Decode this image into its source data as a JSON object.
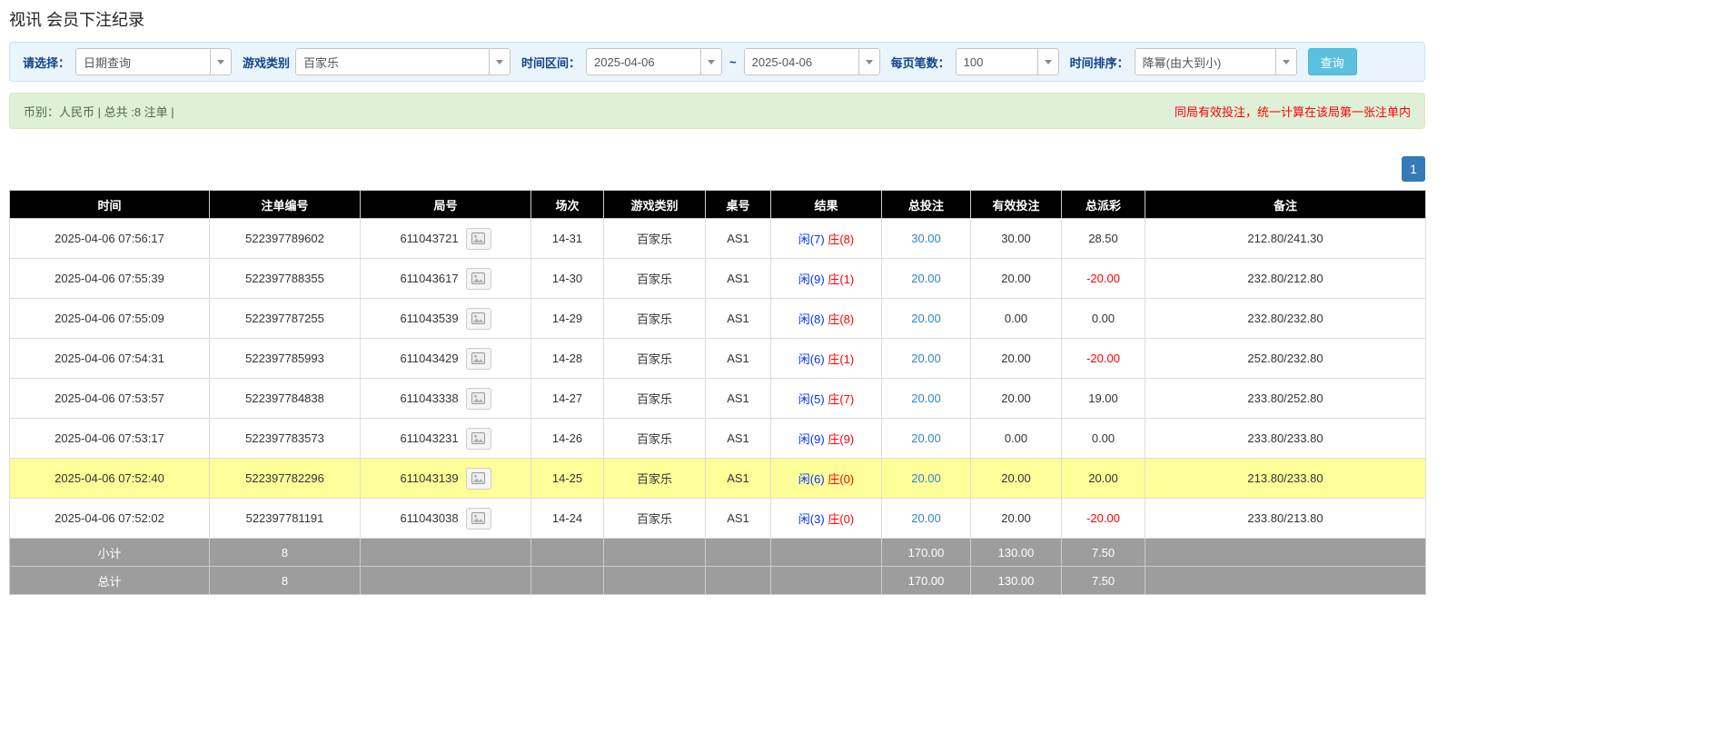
{
  "page": {
    "title": "视讯 会员下注纪录"
  },
  "filters": {
    "select_label": "请选择：",
    "select_value": "日期查询",
    "game_type_label": "游戏类别",
    "game_type_value": "百家乐",
    "time_range_label": "时间区间：",
    "date_from": "2025-04-06",
    "tilde": "~",
    "date_to": "2025-04-06",
    "page_size_label": "每页笔数：",
    "page_size_value": "100",
    "sort_label": "时间排序：",
    "sort_value": "降幂(由大到小)",
    "search_button": "查询"
  },
  "summary": {
    "left": "币别：人民币 | 总共 :8 注单 |",
    "right": "同局有效投注，统一计算在该局第一张注单内"
  },
  "pagination": {
    "current": "1"
  },
  "table": {
    "headers": [
      "时间",
      "注单编号",
      "局号",
      "场次",
      "游戏类别",
      "桌号",
      "结果",
      "总投注",
      "有效投注",
      "总派彩",
      "备注"
    ],
    "rows": [
      {
        "time": "2025-04-06 07:56:17",
        "bet_id": "522397789602",
        "round_id": "611043721",
        "session": "14-31",
        "game": "百家乐",
        "table_no": "AS1",
        "player": "闲(7)",
        "banker": "庄(8)",
        "total_bet": "30.00",
        "valid_bet": "30.00",
        "payout": "28.50",
        "note": "212.80/241.30",
        "highlight": false
      },
      {
        "time": "2025-04-06 07:55:39",
        "bet_id": "522397788355",
        "round_id": "611043617",
        "session": "14-30",
        "game": "百家乐",
        "table_no": "AS1",
        "player": "闲(9)",
        "banker": "庄(1)",
        "total_bet": "20.00",
        "valid_bet": "20.00",
        "payout": "-20.00",
        "note": "232.80/212.80",
        "highlight": false
      },
      {
        "time": "2025-04-06 07:55:09",
        "bet_id": "522397787255",
        "round_id": "611043539",
        "session": "14-29",
        "game": "百家乐",
        "table_no": "AS1",
        "player": "闲(8)",
        "banker": "庄(8)",
        "total_bet": "20.00",
        "valid_bet": "0.00",
        "payout": "0.00",
        "note": "232.80/232.80",
        "highlight": false
      },
      {
        "time": "2025-04-06 07:54:31",
        "bet_id": "522397785993",
        "round_id": "611043429",
        "session": "14-28",
        "game": "百家乐",
        "table_no": "AS1",
        "player": "闲(6)",
        "banker": "庄(1)",
        "total_bet": "20.00",
        "valid_bet": "20.00",
        "payout": "-20.00",
        "note": "252.80/232.80",
        "highlight": false
      },
      {
        "time": "2025-04-06 07:53:57",
        "bet_id": "522397784838",
        "round_id": "611043338",
        "session": "14-27",
        "game": "百家乐",
        "table_no": "AS1",
        "player": "闲(5)",
        "banker": "庄(7)",
        "total_bet": "20.00",
        "valid_bet": "20.00",
        "payout": "19.00",
        "note": "233.80/252.80",
        "highlight": false
      },
      {
        "time": "2025-04-06 07:53:17",
        "bet_id": "522397783573",
        "round_id": "611043231",
        "session": "14-26",
        "game": "百家乐",
        "table_no": "AS1",
        "player": "闲(9)",
        "banker": "庄(9)",
        "total_bet": "20.00",
        "valid_bet": "0.00",
        "payout": "0.00",
        "note": "233.80/233.80",
        "highlight": false
      },
      {
        "time": "2025-04-06 07:52:40",
        "bet_id": "522397782296",
        "round_id": "611043139",
        "session": "14-25",
        "game": "百家乐",
        "table_no": "AS1",
        "player": "闲(6)",
        "banker": "庄(0)",
        "total_bet": "20.00",
        "valid_bet": "20.00",
        "payout": "20.00",
        "note": "213.80/233.80",
        "highlight": true
      },
      {
        "time": "2025-04-06 07:52:02",
        "bet_id": "522397781191",
        "round_id": "611043038",
        "session": "14-24",
        "game": "百家乐",
        "table_no": "AS1",
        "player": "闲(3)",
        "banker": "庄(0)",
        "total_bet": "20.00",
        "valid_bet": "20.00",
        "payout": "-20.00",
        "note": "233.80/213.80",
        "highlight": false
      }
    ],
    "subtotal": {
      "label": "小计",
      "count": "8",
      "total_bet": "170.00",
      "valid_bet": "130.00",
      "payout": "7.50"
    },
    "total": {
      "label": "总计",
      "count": "8",
      "total_bet": "170.00",
      "valid_bet": "130.00",
      "payout": "7.50"
    }
  }
}
